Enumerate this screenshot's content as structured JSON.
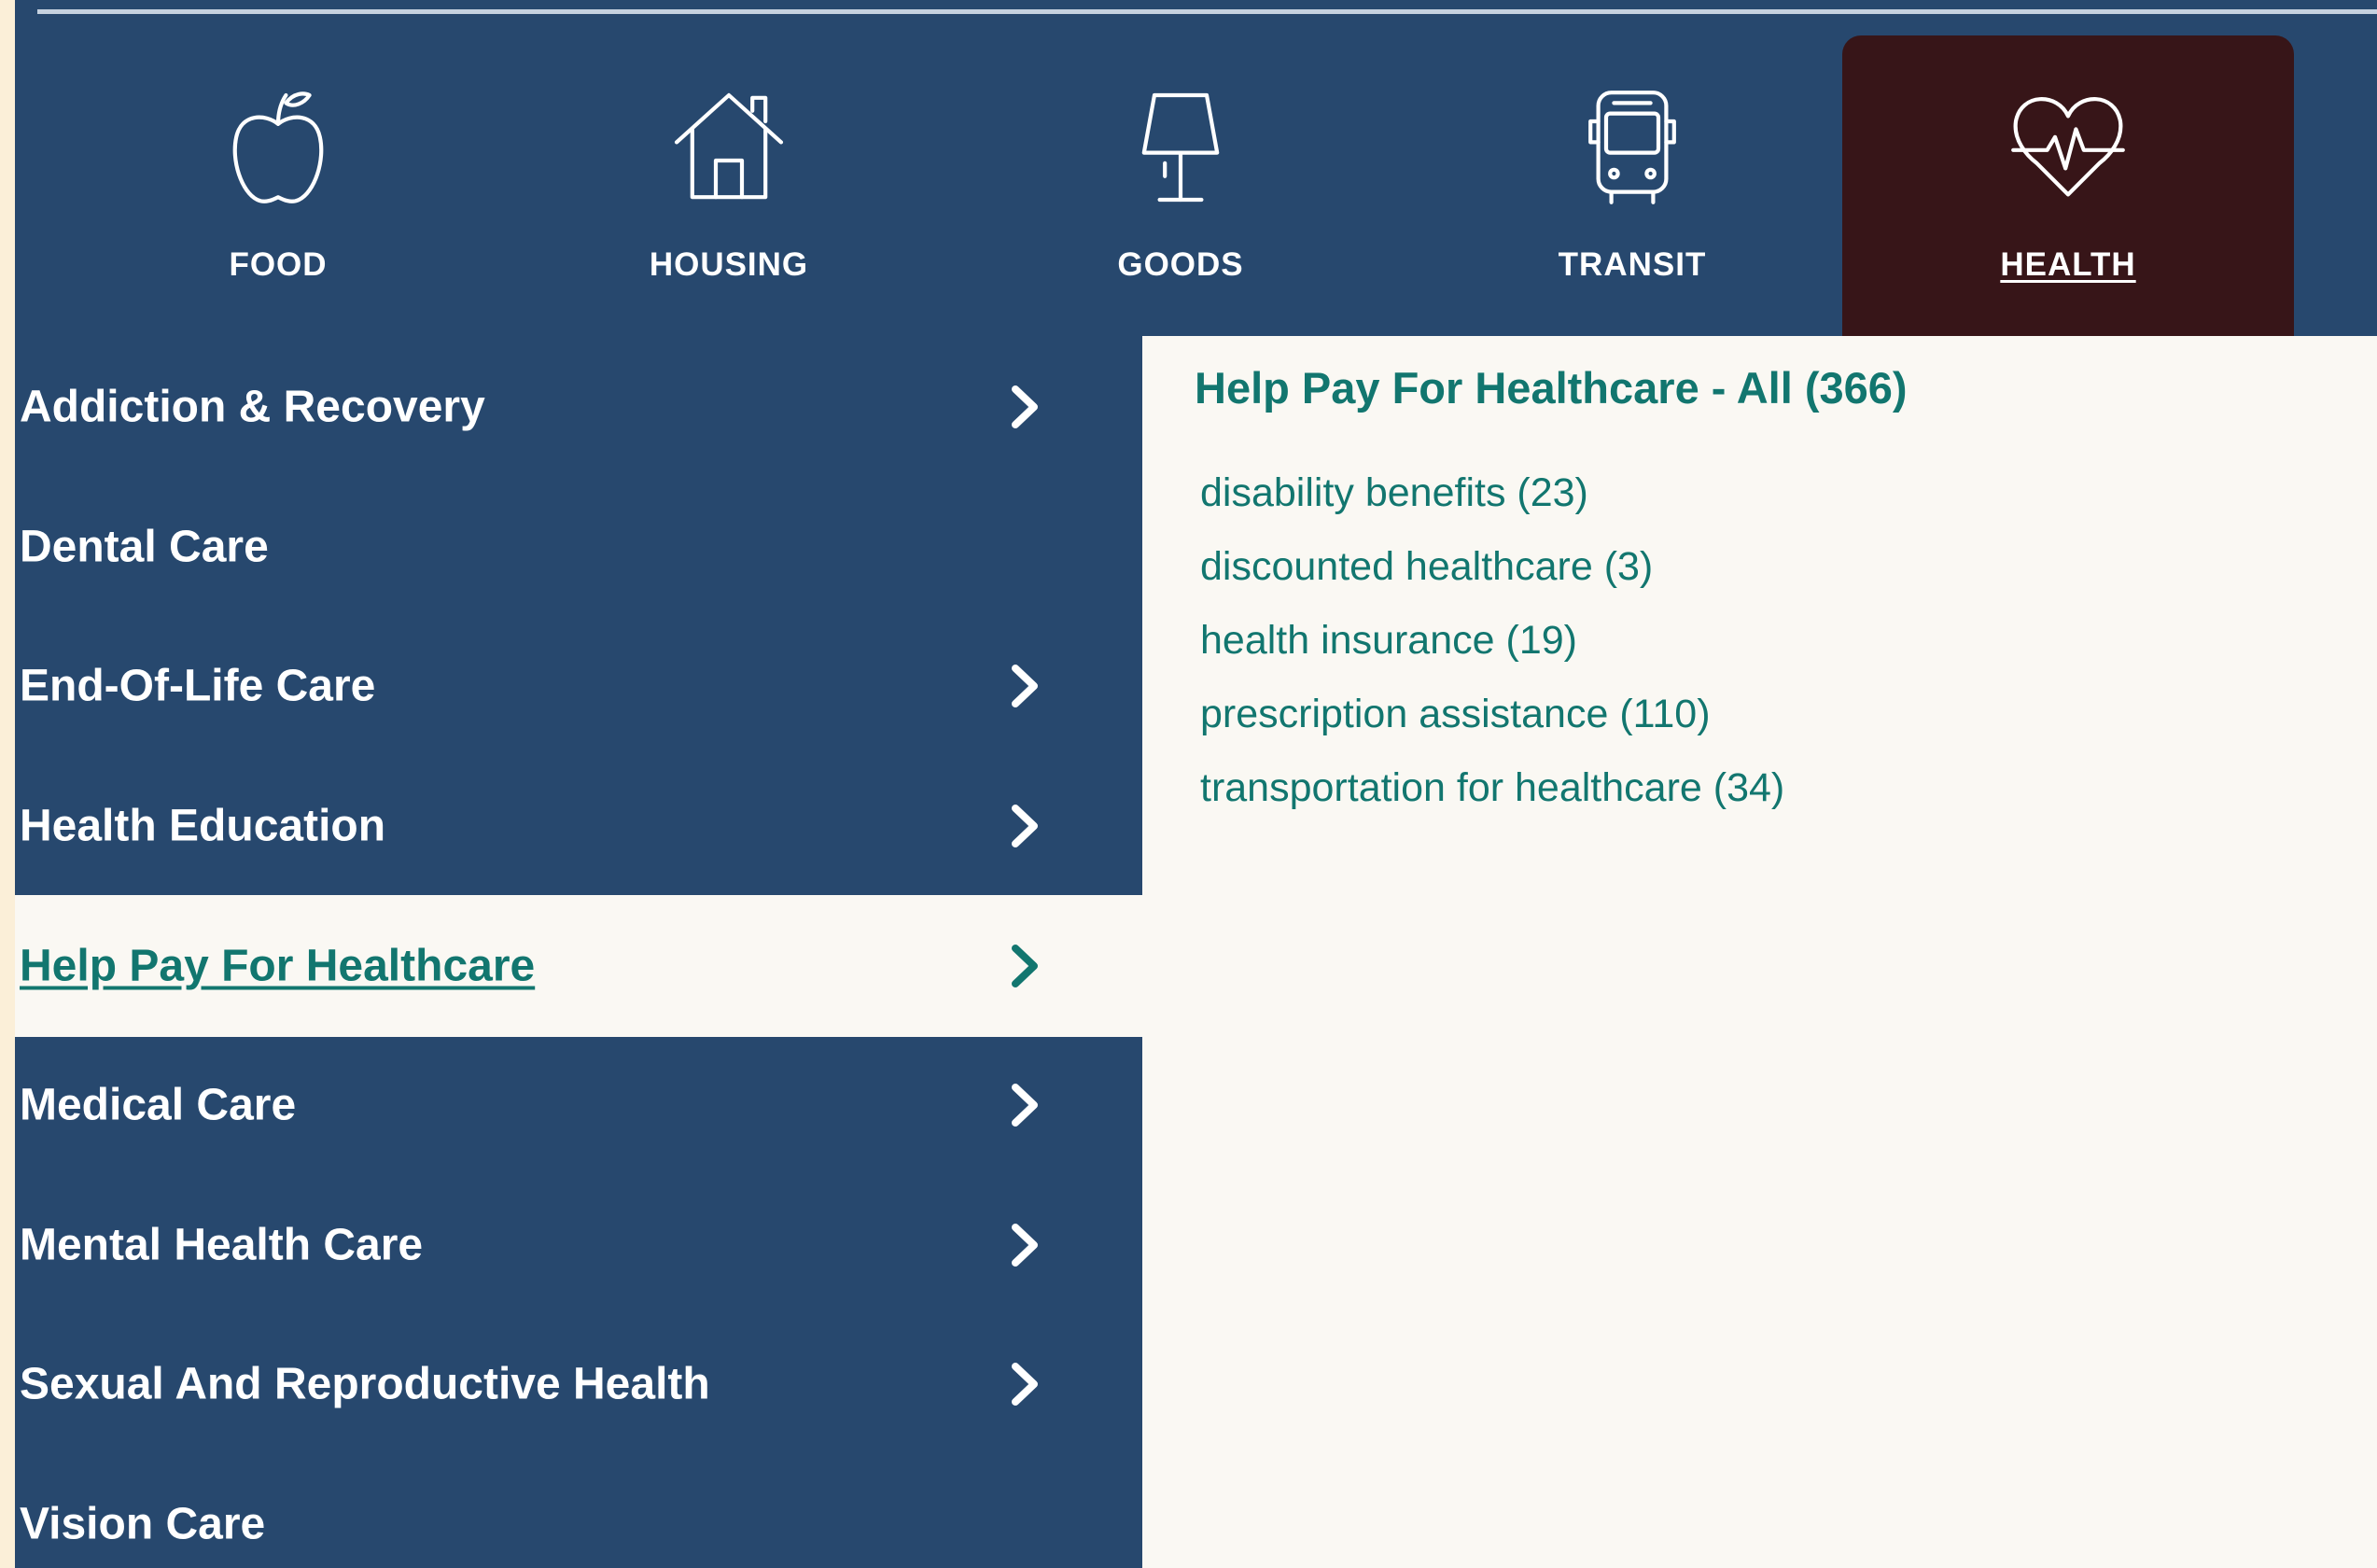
{
  "colors": {
    "nav_bg": "#27486e",
    "active_tab_bg": "#371518",
    "content_bg": "#faf8f3",
    "accent_teal": "#12766f",
    "text_white": "#ffffff"
  },
  "categories": [
    {
      "label": "FOOD",
      "icon": "apple-icon",
      "active": false
    },
    {
      "label": "HOUSING",
      "icon": "house-icon",
      "active": false
    },
    {
      "label": "GOODS",
      "icon": "lamp-icon",
      "active": false
    },
    {
      "label": "TRANSIT",
      "icon": "bus-icon",
      "active": false
    },
    {
      "label": "HEALTH",
      "icon": "heartbeat-icon",
      "active": true
    }
  ],
  "sidebar": {
    "items": [
      {
        "label": "Addiction & Recovery",
        "has_chevron": true,
        "active": false
      },
      {
        "label": "Dental Care",
        "has_chevron": false,
        "active": false
      },
      {
        "label": "End-Of-Life Care",
        "has_chevron": true,
        "active": false
      },
      {
        "label": "Health Education",
        "has_chevron": true,
        "active": false
      },
      {
        "label": "Help Pay For Healthcare",
        "has_chevron": true,
        "active": true
      },
      {
        "label": "Medical Care",
        "has_chevron": true,
        "active": false
      },
      {
        "label": "Mental Health Care",
        "has_chevron": true,
        "active": false
      },
      {
        "label": "Sexual And Reproductive Health",
        "has_chevron": true,
        "active": false
      },
      {
        "label": "Vision Care",
        "has_chevron": false,
        "active": false
      }
    ]
  },
  "main": {
    "heading": "Help Pay For Healthcare - All (366)",
    "subcategories": [
      "disability benefits (23)",
      "discounted healthcare (3)",
      "health insurance (19)",
      "prescription assistance (110)",
      "transportation for healthcare (34)"
    ]
  }
}
